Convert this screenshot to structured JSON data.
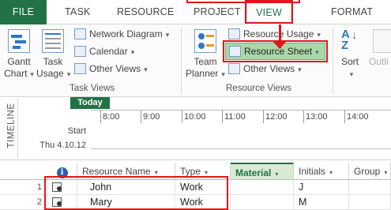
{
  "tabs": {
    "file": "FILE",
    "task": "TASK",
    "resource": "RESOURCE",
    "project": "PROJECT",
    "view": "VIEW",
    "format": "FORMAT"
  },
  "ribbon": {
    "gantt_chart": [
      "Gantt",
      "Chart"
    ],
    "task_usage": [
      "Task",
      "Usage"
    ],
    "network_diagram": "Network Diagram",
    "calendar": "Calendar",
    "other_views_task": "Other Views",
    "task_views_label": "Task Views",
    "team_planner": [
      "Team",
      "Planner"
    ],
    "resource_usage": "Resource Usage",
    "resource_sheet": "Resource Sheet",
    "other_views_resource": "Other Views",
    "resource_views_label": "Resource Views",
    "sort": "Sort",
    "outline": "Outli"
  },
  "timeline": {
    "vertical_label": "TIMELINE",
    "today_label": "Today",
    "times": [
      "8:00",
      "9:00",
      "10:00",
      "11:00",
      "12:00",
      "13:00",
      "14:00"
    ],
    "start_label": "Start",
    "start_date": "Thu 4.10.12"
  },
  "sheet": {
    "columns": {
      "info": "i",
      "resource_name": "Resource Name",
      "type": "Type",
      "material": "Material",
      "initials": "Initials",
      "group": "Group"
    },
    "rows": [
      {
        "num": "1",
        "name": "John",
        "type": "Work",
        "material": "",
        "initials": "J",
        "group": ""
      },
      {
        "num": "2",
        "name": "Mary",
        "type": "Work",
        "material": "",
        "initials": "M",
        "group": ""
      }
    ]
  },
  "colors": {
    "accent": "#217346",
    "highlight": "#e4141b",
    "resource_sheet_bg": "#a9d8a8"
  }
}
